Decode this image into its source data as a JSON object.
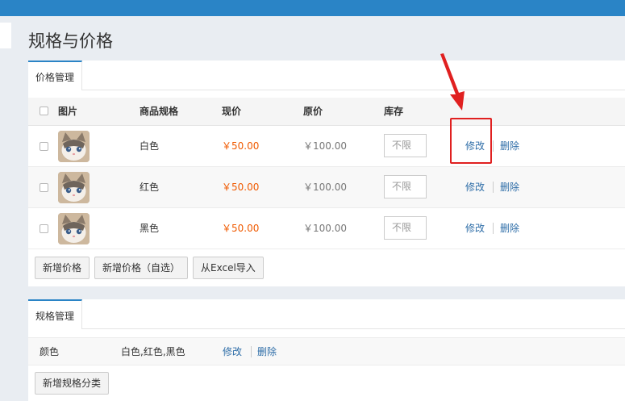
{
  "page": {
    "title": "规格与价格"
  },
  "price_panel": {
    "tab_label": "价格管理",
    "columns": {
      "image": "图片",
      "spec": "商品规格",
      "current_price": "现价",
      "original_price": "原价",
      "stock": "库存"
    },
    "rows": [
      {
        "spec": "白色",
        "current_price": "￥50.00",
        "original_price": "￥100.00",
        "stock_placeholder": "不限",
        "edit": "修改",
        "delete": "删除"
      },
      {
        "spec": "红色",
        "current_price": "￥50.00",
        "original_price": "￥100.00",
        "stock_placeholder": "不限",
        "edit": "修改",
        "delete": "删除"
      },
      {
        "spec": "黑色",
        "current_price": "￥50.00",
        "original_price": "￥100.00",
        "stock_placeholder": "不限",
        "edit": "修改",
        "delete": "删除"
      }
    ],
    "buttons": {
      "add_price": "新增价格",
      "add_price_custom": "新增价格（自选）",
      "import_excel": "从Excel导入"
    }
  },
  "spec_panel": {
    "tab_label": "规格管理",
    "rows": [
      {
        "name": "颜色",
        "values": "白色,红色,黑色",
        "edit": "修改",
        "delete": "删除"
      }
    ],
    "buttons": {
      "add_spec_category": "新增规格分类"
    }
  },
  "colors": {
    "accent": "#2a84c6",
    "price_now": "#f05a00",
    "link": "#2f6ea8",
    "annotation": "#e02020"
  },
  "icons": {
    "thumbnail": "cat-photo-icon",
    "annotation_arrow": "red-arrow-icon"
  }
}
